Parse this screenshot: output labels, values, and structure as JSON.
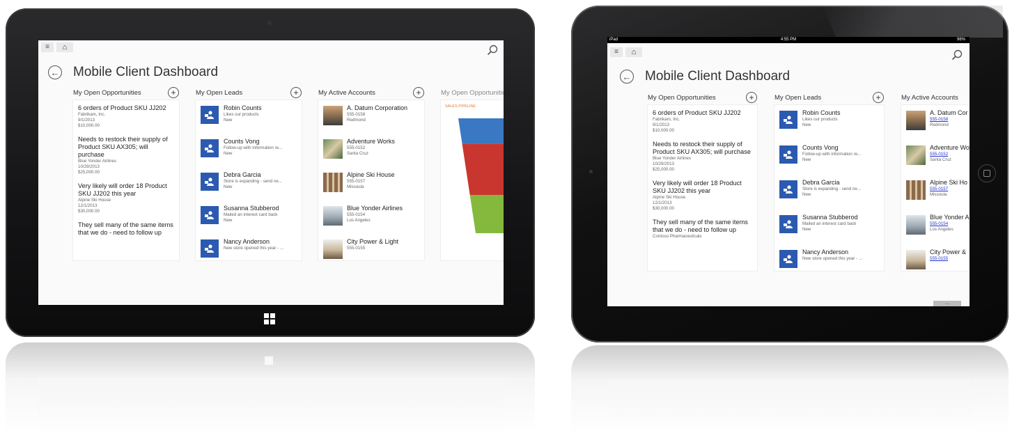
{
  "dashboard": {
    "title": "Mobile Client Dashboard",
    "columns": {
      "opportunities": "My Open Opportunities",
      "leads": "My Open Leads",
      "accounts": "My Active Accounts",
      "opportunities_chart": "My Open Opportunities"
    },
    "opportunities": [
      {
        "title": "6 orders of Product SKU JJ202",
        "account": "Fabrikam, Inc.",
        "date": "9/1/2013",
        "amount": "$10,000.00"
      },
      {
        "title": "Needs to restock their supply of Product SKU AX305; will purchase",
        "account": "Blue Yonder Airlines",
        "date": "10/29/2013",
        "amount": "$25,000.00"
      },
      {
        "title": "Very likely will order 18 Product SKU JJ202 this year",
        "account": "Alpine Ski House",
        "date": "12/1/2013",
        "amount": "$30,000.00"
      },
      {
        "title": "They sell many of the same items that we do - need to follow up",
        "account": "Contoso Pharmaceuticals"
      }
    ],
    "leads": [
      {
        "name": "Robin Counts",
        "topic": "Likes our products",
        "status": "New"
      },
      {
        "name": "Counts Vong",
        "topic_win": "Follow-up with information re...",
        "topic_ipad": "Follow-up with information re...",
        "status": "New"
      },
      {
        "name": "Debra Garcia",
        "topic_win": "Store is expanding - send ne...",
        "topic_ipad": "Store is expanding - send ne...",
        "status": "New"
      },
      {
        "name": "Susanna Stubberod",
        "topic": "Mailed an interest card back",
        "status": "New"
      },
      {
        "name": "Nancy Anderson",
        "topic": "New store opened this year - ...",
        "status": ""
      }
    ],
    "accounts": [
      {
        "name": "A. Datum Corporation",
        "phone": "555-0158",
        "city": "Redmond"
      },
      {
        "name": "Adventure Works",
        "phone": "555-0152",
        "city": "Santa Cruz"
      },
      {
        "name": "Alpine Ski House",
        "phone": "555-0157",
        "city": "Missoula"
      },
      {
        "name": "Blue Yonder Airlines",
        "phone": "555-0154",
        "city": "Los Angeles"
      },
      {
        "name": "City Power & Light",
        "phone": "555-0155",
        "city": ""
      }
    ],
    "ipad_accounts": [
      {
        "name": "A. Datum Cor"
      },
      {
        "name": "Adventure Wo"
      },
      {
        "name": "Alpine Ski Ho"
      },
      {
        "name": "Blue Yonder A"
      },
      {
        "name": "City Power &"
      }
    ],
    "chart_label": "SALES PIPELINE"
  },
  "ipad_status": {
    "carrier": "iPad",
    "time": "4:55 PM",
    "battery": "96%"
  },
  "ipad_more": "...",
  "colors": {
    "funnel": [
      "#3a78c4",
      "#c8362f",
      "#84b93d"
    ],
    "lead_icon": "#2b5ab0",
    "chart_label": "#e67a2e"
  },
  "chart_data": {
    "type": "funnel",
    "title": "SALES PIPELINE",
    "stages": [
      {
        "value": 1
      },
      {
        "value": 2
      },
      {
        "value": 1.5
      }
    ]
  }
}
